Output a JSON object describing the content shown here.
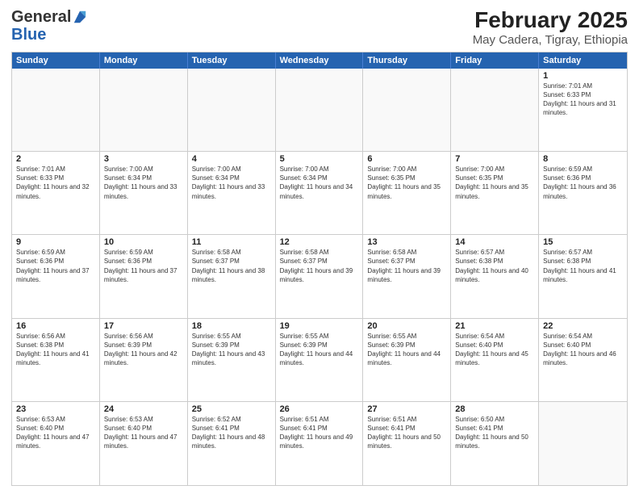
{
  "header": {
    "logo_general": "General",
    "logo_blue": "Blue",
    "title": "February 2025",
    "subtitle": "May Cadera, Tigray, Ethiopia"
  },
  "calendar": {
    "days_of_week": [
      "Sunday",
      "Monday",
      "Tuesday",
      "Wednesday",
      "Thursday",
      "Friday",
      "Saturday"
    ],
    "weeks": [
      [
        {
          "day": "",
          "info": ""
        },
        {
          "day": "",
          "info": ""
        },
        {
          "day": "",
          "info": ""
        },
        {
          "day": "",
          "info": ""
        },
        {
          "day": "",
          "info": ""
        },
        {
          "day": "",
          "info": ""
        },
        {
          "day": "1",
          "info": "Sunrise: 7:01 AM\nSunset: 6:33 PM\nDaylight: 11 hours and 31 minutes."
        }
      ],
      [
        {
          "day": "2",
          "info": "Sunrise: 7:01 AM\nSunset: 6:33 PM\nDaylight: 11 hours and 32 minutes."
        },
        {
          "day": "3",
          "info": "Sunrise: 7:00 AM\nSunset: 6:34 PM\nDaylight: 11 hours and 33 minutes."
        },
        {
          "day": "4",
          "info": "Sunrise: 7:00 AM\nSunset: 6:34 PM\nDaylight: 11 hours and 33 minutes."
        },
        {
          "day": "5",
          "info": "Sunrise: 7:00 AM\nSunset: 6:34 PM\nDaylight: 11 hours and 34 minutes."
        },
        {
          "day": "6",
          "info": "Sunrise: 7:00 AM\nSunset: 6:35 PM\nDaylight: 11 hours and 35 minutes."
        },
        {
          "day": "7",
          "info": "Sunrise: 7:00 AM\nSunset: 6:35 PM\nDaylight: 11 hours and 35 minutes."
        },
        {
          "day": "8",
          "info": "Sunrise: 6:59 AM\nSunset: 6:36 PM\nDaylight: 11 hours and 36 minutes."
        }
      ],
      [
        {
          "day": "9",
          "info": "Sunrise: 6:59 AM\nSunset: 6:36 PM\nDaylight: 11 hours and 37 minutes."
        },
        {
          "day": "10",
          "info": "Sunrise: 6:59 AM\nSunset: 6:36 PM\nDaylight: 11 hours and 37 minutes."
        },
        {
          "day": "11",
          "info": "Sunrise: 6:58 AM\nSunset: 6:37 PM\nDaylight: 11 hours and 38 minutes."
        },
        {
          "day": "12",
          "info": "Sunrise: 6:58 AM\nSunset: 6:37 PM\nDaylight: 11 hours and 39 minutes."
        },
        {
          "day": "13",
          "info": "Sunrise: 6:58 AM\nSunset: 6:37 PM\nDaylight: 11 hours and 39 minutes."
        },
        {
          "day": "14",
          "info": "Sunrise: 6:57 AM\nSunset: 6:38 PM\nDaylight: 11 hours and 40 minutes."
        },
        {
          "day": "15",
          "info": "Sunrise: 6:57 AM\nSunset: 6:38 PM\nDaylight: 11 hours and 41 minutes."
        }
      ],
      [
        {
          "day": "16",
          "info": "Sunrise: 6:56 AM\nSunset: 6:38 PM\nDaylight: 11 hours and 41 minutes."
        },
        {
          "day": "17",
          "info": "Sunrise: 6:56 AM\nSunset: 6:39 PM\nDaylight: 11 hours and 42 minutes."
        },
        {
          "day": "18",
          "info": "Sunrise: 6:55 AM\nSunset: 6:39 PM\nDaylight: 11 hours and 43 minutes."
        },
        {
          "day": "19",
          "info": "Sunrise: 6:55 AM\nSunset: 6:39 PM\nDaylight: 11 hours and 44 minutes."
        },
        {
          "day": "20",
          "info": "Sunrise: 6:55 AM\nSunset: 6:39 PM\nDaylight: 11 hours and 44 minutes."
        },
        {
          "day": "21",
          "info": "Sunrise: 6:54 AM\nSunset: 6:40 PM\nDaylight: 11 hours and 45 minutes."
        },
        {
          "day": "22",
          "info": "Sunrise: 6:54 AM\nSunset: 6:40 PM\nDaylight: 11 hours and 46 minutes."
        }
      ],
      [
        {
          "day": "23",
          "info": "Sunrise: 6:53 AM\nSunset: 6:40 PM\nDaylight: 11 hours and 47 minutes."
        },
        {
          "day": "24",
          "info": "Sunrise: 6:53 AM\nSunset: 6:40 PM\nDaylight: 11 hours and 47 minutes."
        },
        {
          "day": "25",
          "info": "Sunrise: 6:52 AM\nSunset: 6:41 PM\nDaylight: 11 hours and 48 minutes."
        },
        {
          "day": "26",
          "info": "Sunrise: 6:51 AM\nSunset: 6:41 PM\nDaylight: 11 hours and 49 minutes."
        },
        {
          "day": "27",
          "info": "Sunrise: 6:51 AM\nSunset: 6:41 PM\nDaylight: 11 hours and 50 minutes."
        },
        {
          "day": "28",
          "info": "Sunrise: 6:50 AM\nSunset: 6:41 PM\nDaylight: 11 hours and 50 minutes."
        },
        {
          "day": "",
          "info": ""
        }
      ]
    ]
  }
}
